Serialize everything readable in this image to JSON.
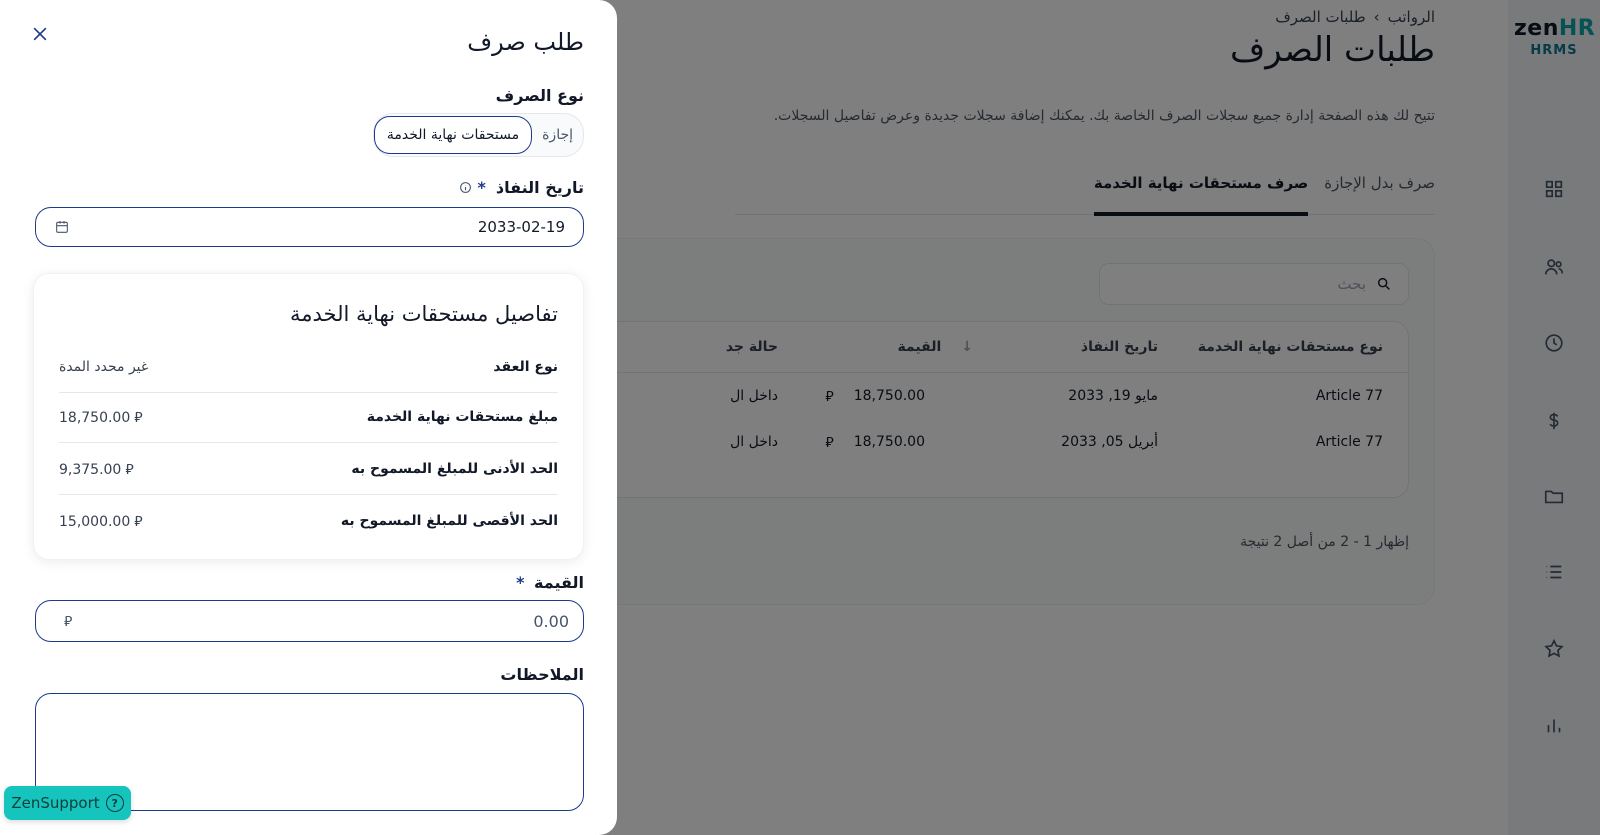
{
  "brand": {
    "name_part1": "zen",
    "name_part2": "HR",
    "sub": "HRMS"
  },
  "sidebar": {
    "icons": [
      "dashboard-icon",
      "people-icon",
      "clock-icon",
      "dollar-icon",
      "folder-icon",
      "list-icon",
      "star-icon",
      "chart-icon"
    ]
  },
  "breadcrumb": {
    "root": "الرواتب",
    "separator": "›",
    "current": "طلبات الصرف"
  },
  "page": {
    "title": "طلبات الصرف",
    "description": "تتيح لك هذه الصفحة إدارة جميع سجلات الصرف الخاصة بك. يمكنك إضافة سجلات جديدة وعرض تفاصيل السجلات."
  },
  "tabs": [
    {
      "label": "صرف بدل الإجازة",
      "active": false
    },
    {
      "label": "صرف مستحقات نهاية الخدمة",
      "active": true
    }
  ],
  "search": {
    "placeholder": "بحث"
  },
  "table": {
    "headers": [
      "نوع مستحقات نهاية الخدمة",
      "تاريخ النفاذ",
      "القيمة",
      "حالة جد"
    ],
    "rows": [
      {
        "type": "Article 77",
        "date": "مايو 19, 2033",
        "amount": "18,750.00",
        "status": "داخل ال"
      },
      {
        "type": "Article 77",
        "date": "أبريل 05, 2033",
        "amount": "18,750.00",
        "status": "داخل ال"
      }
    ],
    "currency_symbol": "⃁"
  },
  "pagination": {
    "text": "إظهار 1 - 2 من أصل 2 نتيجة"
  },
  "drawer": {
    "title": "طلب صرف",
    "type_label": "نوع الصرف",
    "type_options": [
      "إجازة",
      "مستحقات نهاية الخدمة"
    ],
    "type_selected": "مستحقات نهاية الخدمة",
    "date_label": "تاريخ النفاذ",
    "required_mark": "*",
    "date_value": "2033-02-19",
    "details_title": "تفاصيل مستحقات نهاية الخدمة",
    "details": [
      {
        "key": "نوع العقد",
        "value": "غير محدد المدة"
      },
      {
        "key": "مبلغ مستحقات نهاية الخدمة",
        "value": "18,750.00"
      },
      {
        "key": "الحد الأدنى للمبلغ المسموح به",
        "value": "9,375.00"
      },
      {
        "key": "الحد الأقصى للمبلغ المسموح به",
        "value": "15,000.00"
      }
    ],
    "amount_label": "القيمة",
    "amount_value": "0.00",
    "notes_label": "الملاحظات"
  },
  "support": {
    "label": "ZenSupport",
    "icon": "?"
  }
}
